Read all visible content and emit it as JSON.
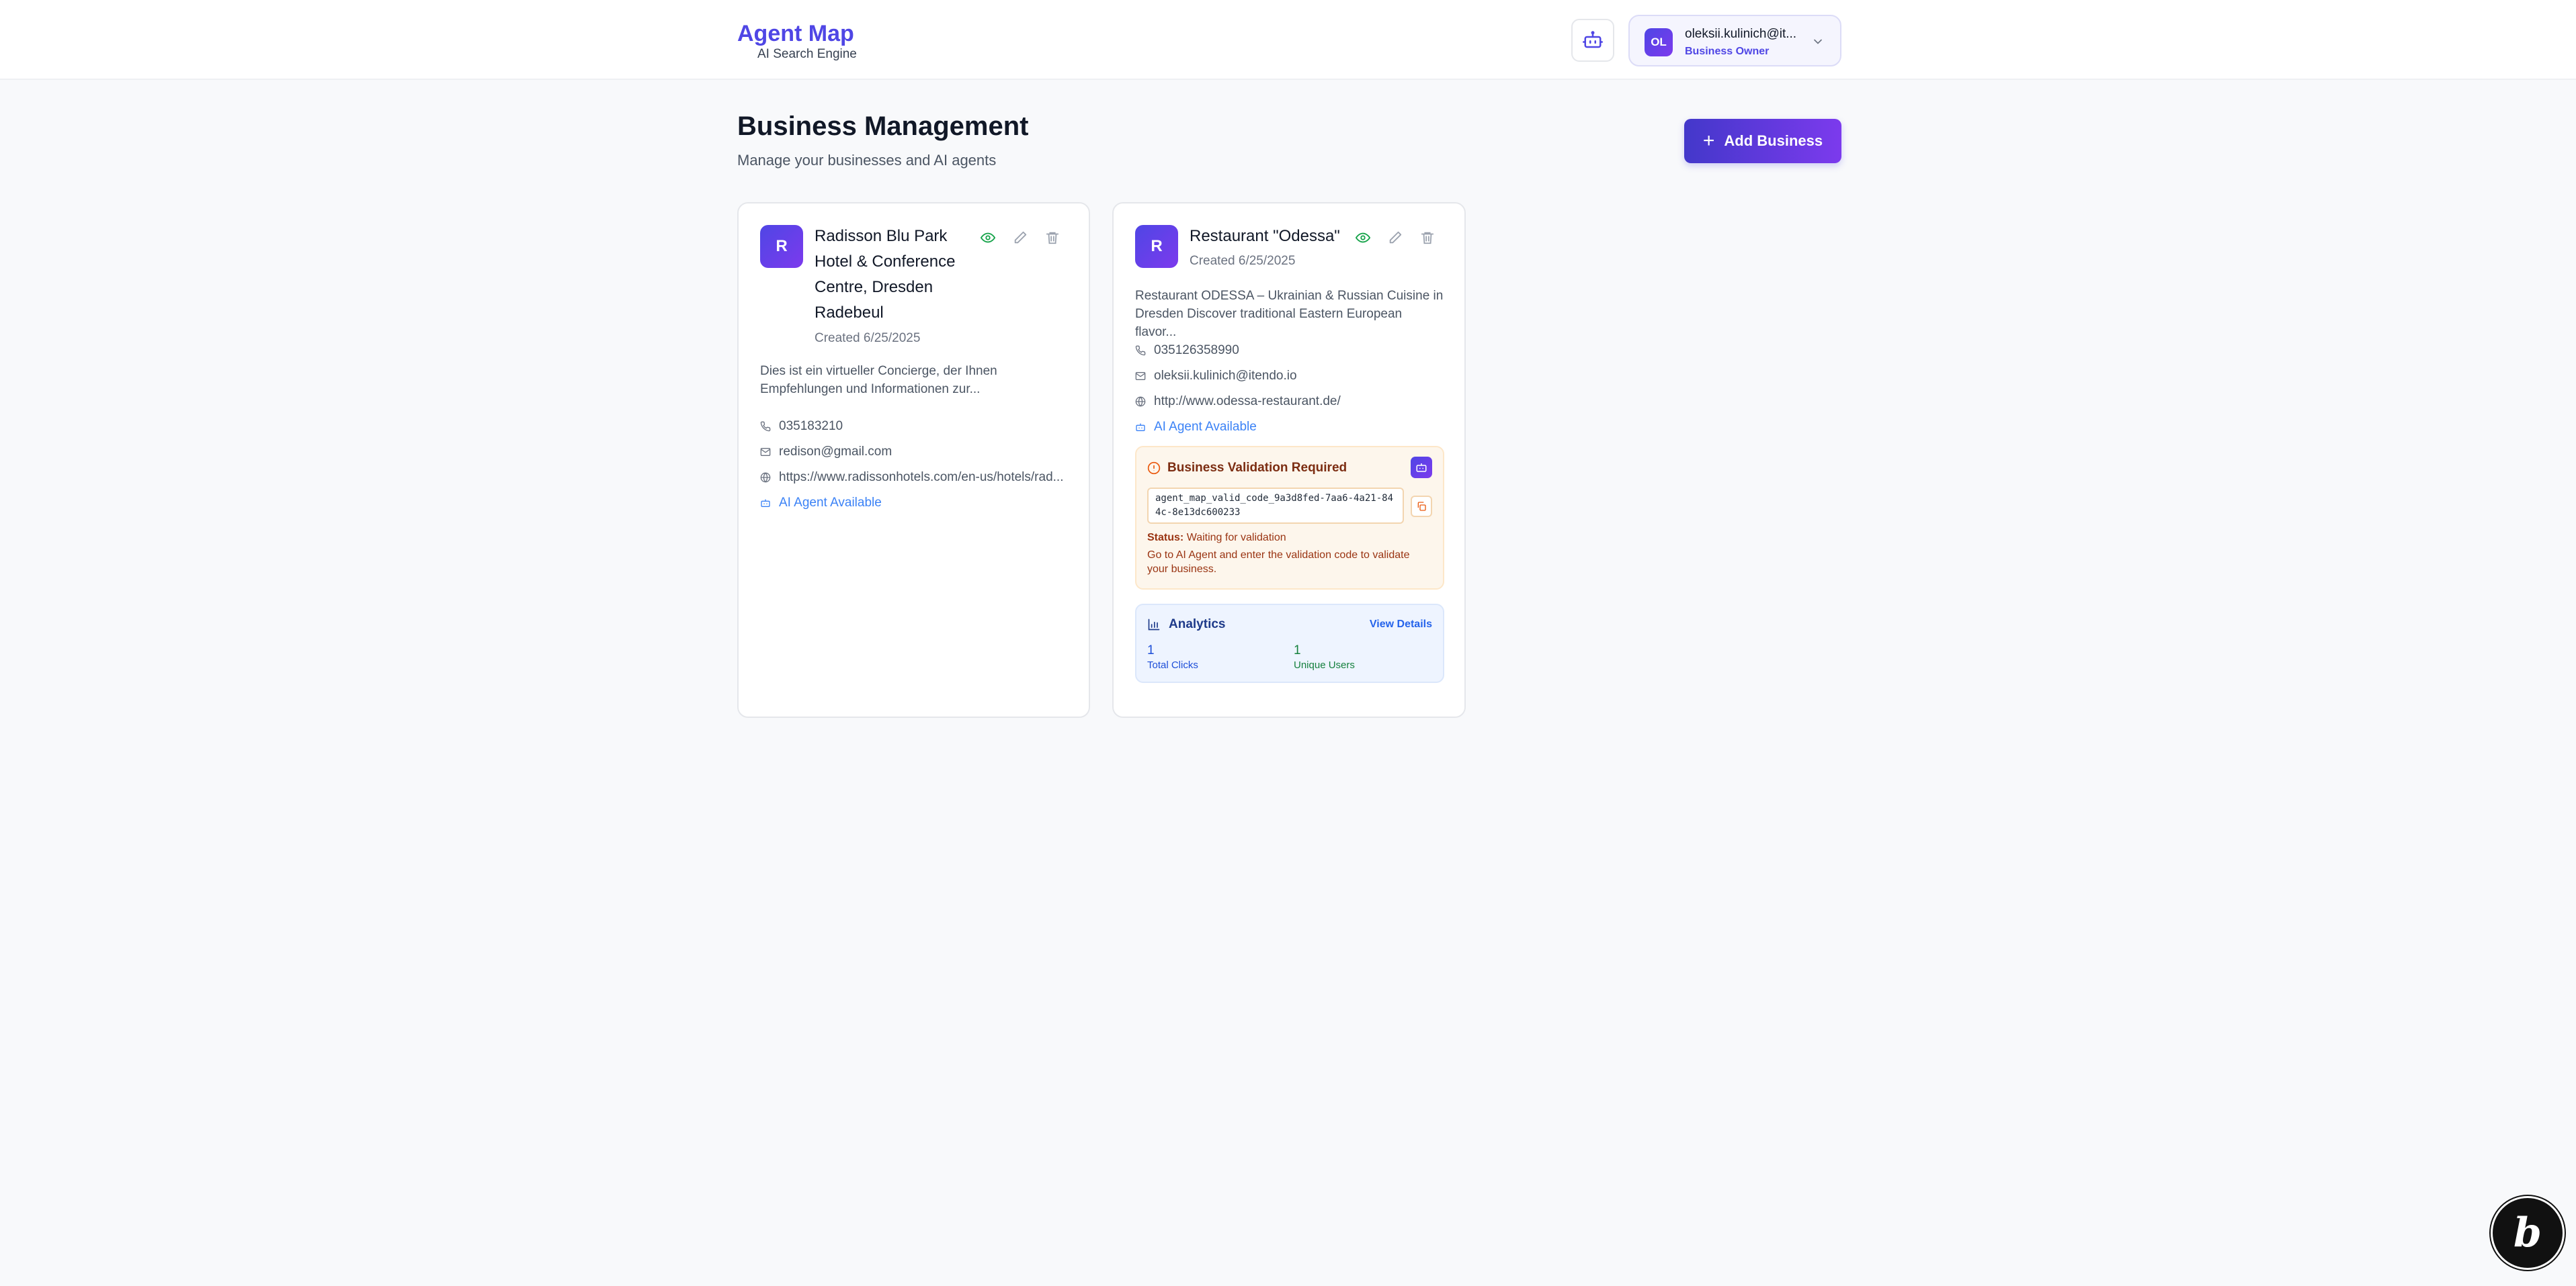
{
  "header": {
    "brand_title": "Agent Map",
    "brand_subtitle": "AI Search Engine",
    "bot_icon": "bot-icon",
    "user": {
      "initials": "OL",
      "email": "oleksii.kulinich@it...",
      "role": "Business Owner"
    }
  },
  "page": {
    "title": "Business Management",
    "subtitle": "Manage your businesses and AI agents",
    "add_button": "Add Business"
  },
  "businesses": [
    {
      "initial": "R",
      "name": "Radisson Blu Park Hotel & Conference Centre, Dresden Radebeul",
      "created": "Created 6/25/2025",
      "description": "Dies ist ein virtueller Concierge, der Ihnen Empfehlungen und Informationen zur...",
      "phone": "035183210",
      "email": "redison@gmail.com",
      "website": "https://www.radissonhotels.com/en-us/hotels/rad...",
      "agent_status": "AI Agent Available"
    },
    {
      "initial": "R",
      "name": "Restaurant \"Odessa\"",
      "created": "Created 6/25/2025",
      "description": "Restaurant ODESSA – Ukrainian & Russian Cuisine in Dresden Discover traditional Eastern European flavor...",
      "phone": "035126358990",
      "email": "oleksii.kulinich@itendo.io",
      "website": "http://www.odessa-restaurant.de/",
      "agent_status": "AI Agent Available",
      "validation": {
        "title": "Business Validation Required",
        "code": "agent_map_valid_code_9a3d8fed-7aa6-4a21-844c-8e13dc600233",
        "status_label": "Status:",
        "status_value": "Waiting for validation",
        "help": "Go to AI Agent and enter the validation code to validate your business."
      },
      "analytics": {
        "title": "Analytics",
        "link": "View Details",
        "total_clicks": "1",
        "total_clicks_label": "Total Clicks",
        "unique_users": "1",
        "unique_users_label": "Unique Users"
      }
    }
  ],
  "colors": {
    "accent": "#4f46e5",
    "accent_purple": "#7c3aed",
    "link_blue": "#3b82f6",
    "warning_bg": "#fdf6ec",
    "analytics_bg": "#eef4ff",
    "success_green": "#16a34a"
  }
}
